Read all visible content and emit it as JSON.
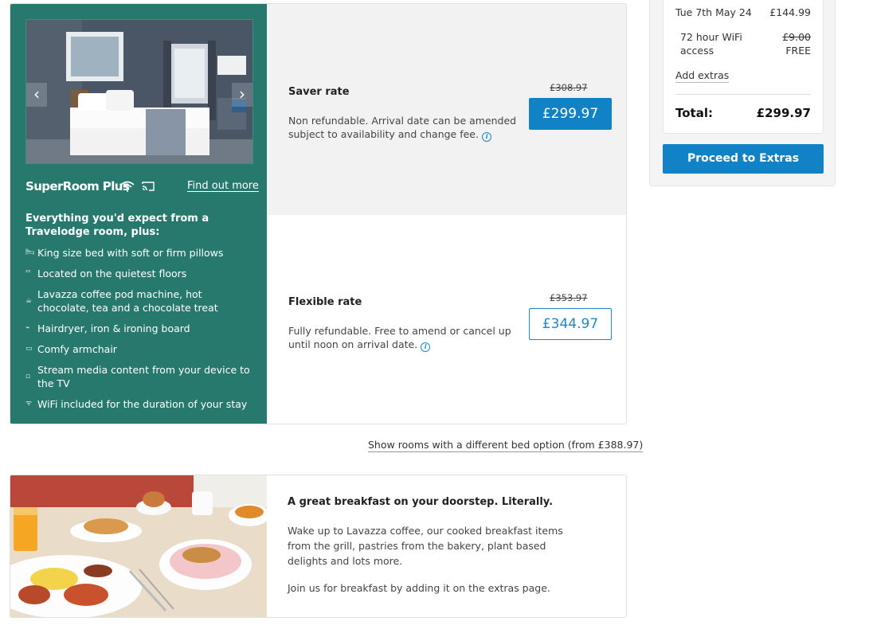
{
  "room": {
    "name": "SuperRoom Plus",
    "find_out_more": "Find out more",
    "photo_prev": "‹",
    "photo_next": "›",
    "features_heading": "Everything you'd expect from a Travelodge room, plus:",
    "features": [
      {
        "icon": "bed-icon",
        "text": "King size bed with soft or firm pillows"
      },
      {
        "icon": "quiet-icon",
        "text": "Located on the quietest floors"
      },
      {
        "icon": "coffee-icon",
        "text": "Lavazza coffee pod machine, hot chocolate, tea and a chocolate treat"
      },
      {
        "icon": "hairdryer-icon",
        "text": "Hairdryer, iron & ironing board"
      },
      {
        "icon": "armchair-icon",
        "text": "Comfy armchair"
      },
      {
        "icon": "cast-icon",
        "text": "Stream media content from your device to the TV"
      },
      {
        "icon": "wifi-icon",
        "text": "WiFi included for the duration of your stay"
      }
    ]
  },
  "rates": {
    "saver": {
      "title": "Saver rate",
      "description": "Non refundable. Arrival date can be amended subject to availability and change fee.",
      "old_price": "£308.97",
      "price": "£299.97"
    },
    "flexible": {
      "title": "Flexible rate",
      "description": "Fully refundable. Free to amend or cancel up until noon on arrival date.",
      "old_price": "£353.97",
      "price": "£344.97"
    }
  },
  "bed_option_link": "Show rooms with a different bed option (from £388.97)",
  "breakfast": {
    "title": "A great breakfast on your doorstep. Literally.",
    "text": "Wake up to Lavazza coffee, our cooked breakfast items from the grill, pastries from the bakery, plant based delights and lots more.",
    "join": "Join us for breakfast by adding it on the extras page."
  },
  "summary": {
    "date_label": "Tue 7th May 24",
    "date_price": "£144.99",
    "wifi_label": "72 hour WiFi access",
    "wifi_old_price": "£9.00",
    "wifi_price": "FREE",
    "add_extras": "Add extras",
    "total_label": "Total:",
    "total_value": "£299.97",
    "proceed": "Proceed to Extras"
  },
  "colors": {
    "room_panel": "#27786d",
    "primary_blue": "#1282c6"
  }
}
